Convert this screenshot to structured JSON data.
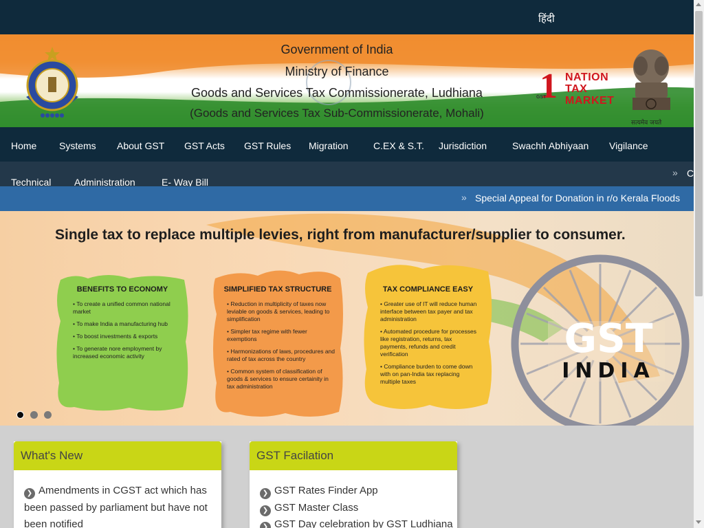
{
  "topbar": {
    "language_link": "हिंदी"
  },
  "header": {
    "line1": "Government of India",
    "line2": "Ministry of Finance",
    "line3": "Goods and Services Tax Commissionerate, Ludhiana",
    "line4": "(Goods and Services Tax Sub-Commissionerate, Mohali)",
    "logo_campaign": {
      "number": "1",
      "line1": "NATION",
      "line2": "TAX",
      "line3": "MARKET",
      "tag": "GST"
    },
    "emblem_caption": "सत्यमेव जयते"
  },
  "nav": {
    "items": [
      "Home",
      "Systems",
      "About GST",
      "GST Acts",
      "GST Rules",
      "Migration",
      "C.EX & S.T.",
      "Jurisdiction",
      "Swachh Abhiyaan",
      "Vigilance",
      "Technical",
      "Administration",
      "E- Way Bill"
    ],
    "overflow_arrow": "»",
    "overflow_text": "C"
  },
  "ticker": {
    "arrow": "»",
    "text": "Special Appeal for Donation in r/o Kerala Floods"
  },
  "banner": {
    "headline": "Single tax  to replace multiple levies, right from manufacturer/supplier to consumer.",
    "panels": [
      {
        "title": "BENEFITS TO ECONOMY",
        "color": "#8fce4e",
        "points": [
          "To create a unified common national market",
          "To make India a manufacturing hub",
          "To boost investments & exports",
          "To generate nore employment by increased economic activity"
        ]
      },
      {
        "title": "SIMPLIFIED TAX STRUCTURE",
        "color": "#f39a4a",
        "points": [
          "Reduction in multiplicity of taxes now leviable on goods & services, leading to simplification",
          "Simpler tax regime with fewer exemptions",
          "Harmonizations of laws, procedures and rated of tax across the country",
          "Common system of classification of goods & services to ensure certainity in tax administration"
        ]
      },
      {
        "title": "TAX COMPLIANCE EASY",
        "color": "#f6c43a",
        "points": [
          "Greater use of IT will reduce human interface between tax payer and tax administration",
          "Automated procedure for processes like registration, returns, tax payments, refunds and credit verification",
          "Compliance burden to come down with on pan-India tax replacing multiple taxes"
        ]
      }
    ],
    "gst_logo": {
      "word": "GST",
      "sub": "INDIA"
    },
    "slides": 3,
    "active_slide": 1
  },
  "whats_new": {
    "title": "What's New",
    "items": [
      "Amendments in CGST act which has been passed by parliament but have not been notified"
    ]
  },
  "gst_facilitation": {
    "title": "GST Facilation",
    "items": [
      "GST Rates Finder App",
      "GST Master Class",
      "GST Day celebration by GST Ludhiana"
    ]
  },
  "colors": {
    "navy": "#0f2a3c",
    "ticker_blue": "#2f6aa5",
    "card_header": "#c9d616"
  }
}
